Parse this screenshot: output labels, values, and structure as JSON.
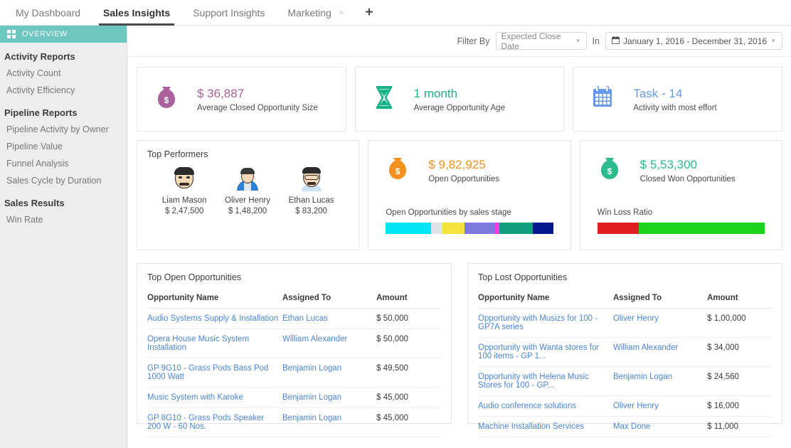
{
  "tabs": [
    {
      "label": "My Dashboard",
      "active": false,
      "closable": false
    },
    {
      "label": "Sales Insights",
      "active": true,
      "closable": false
    },
    {
      "label": "Support Insights",
      "active": false,
      "closable": false
    },
    {
      "label": "Marketing",
      "active": false,
      "closable": true
    }
  ],
  "tab_add_label": "+",
  "tab_close_glyph": "×",
  "sidebar": {
    "overview_label": "OVERVIEW",
    "groups": [
      {
        "title": "Activity Reports",
        "items": [
          "Activity Count",
          "Activity Efficiency"
        ]
      },
      {
        "title": "Pipeline Reports",
        "items": [
          "Pipeline Activity by Owner",
          "Pipeline Value",
          "Funnel Analysis",
          "Sales Cycle by Duration"
        ]
      },
      {
        "title": "Sales Results",
        "items": [
          "Win Rate"
        ]
      }
    ]
  },
  "filter": {
    "filter_by_label": "Filter By",
    "filter_by_value": "Expected Close Date",
    "in_label": "In",
    "date_range": "January 1, 2016 - December 31, 2016",
    "calendar_glyph": "📅",
    "caret_glyph": "▼"
  },
  "kpis": [
    {
      "icon": "money-bag-icon",
      "value": "$ 36,887",
      "label": "Average Closed Opportunity Size",
      "color": "#a9609b"
    },
    {
      "icon": "hourglass-icon",
      "value": "1 month",
      "label": "Average Opportunity Age",
      "color": "#16b187"
    },
    {
      "icon": "calendar-icon",
      "value": "Task - 14",
      "label": "Activity with most effort",
      "color": "#6699e8"
    }
  ],
  "top_performers": {
    "title": "Top Performers",
    "people": [
      {
        "name": "Liam Mason",
        "amount": "$ 2,47,500"
      },
      {
        "name": "Oliver Henry",
        "amount": "$ 1,48,200"
      },
      {
        "name": "Ethan Lucas",
        "amount": "$ 83,200"
      }
    ]
  },
  "open_opportunities": {
    "icon": "money-bag-icon",
    "value": "$ 9,82,925",
    "label": "Open Opportunities",
    "color": "#f5911e",
    "bar_label": "Open Opportunities by sales stage",
    "segments": [
      {
        "name": "stage-1",
        "color": "#00e5f5",
        "pct": 27
      },
      {
        "name": "stage-2",
        "color": "#dfe3e8",
        "pct": 7
      },
      {
        "name": "stage-3",
        "color": "#f6e23c",
        "pct": 13
      },
      {
        "name": "stage-4",
        "color": "#7c79e0",
        "pct": 18
      },
      {
        "name": "stage-5",
        "color": "#ff3ce0",
        "pct": 3
      },
      {
        "name": "stage-6",
        "color": "#0f9e7e",
        "pct": 20
      },
      {
        "name": "stage-7",
        "color": "#041a8c",
        "pct": 12
      }
    ]
  },
  "closed_won": {
    "icon": "money-bag-icon",
    "value": "$ 5,53,300",
    "label": "Closed Won Opportunities",
    "color": "#2bbb8d",
    "bar_label": "Win Loss Ratio",
    "segments": [
      {
        "name": "loss",
        "color": "#e02020",
        "pct": 25
      },
      {
        "name": "win",
        "color": "#1bd41b",
        "pct": 75
      }
    ]
  },
  "top_open_table": {
    "title": "Top Open Opportunities",
    "columns": [
      "Opportunity Name",
      "Assigned To",
      "Amount"
    ],
    "rows": [
      [
        "Audio Systems Supply & Installation",
        "Ethan Lucas",
        "$ 50,000"
      ],
      [
        "Opera House Music System Installation",
        "William Alexander",
        "$ 50,000"
      ],
      [
        "GP 9G10 - Grass Pods Bass Pod 1000 Watt",
        "Benjamin Logan",
        "$ 49,500"
      ],
      [
        "Music System with Karoke",
        "Benjamin Logan",
        "$ 45,000"
      ],
      [
        "GP 8G10 - Grass Pods Speaker 200 W - 60 Nos.",
        "Benjamin Logan",
        "$ 45,000"
      ]
    ]
  },
  "top_lost_table": {
    "title": "Top Lost Opportunities",
    "columns": [
      "Opportunity Name",
      "Assigned To",
      "Amount"
    ],
    "rows": [
      [
        "Opportunity with Musizs for 100 - GP7A series",
        "Oliver Henry",
        "$ 1,00,000"
      ],
      [
        "Opportunity with Wanta stores for 100 items - GP 1...",
        "William Alexander",
        "$ 34,000"
      ],
      [
        "Opportunity with Helena Music Stores for 100 - GP...",
        "Benjamin Logan",
        "$ 24,560"
      ],
      [
        "Audio conference solutions",
        "Oliver Henry",
        "$ 16,000"
      ],
      [
        "Machine Installation Services",
        "Max Done",
        "$ 11,000"
      ]
    ]
  }
}
